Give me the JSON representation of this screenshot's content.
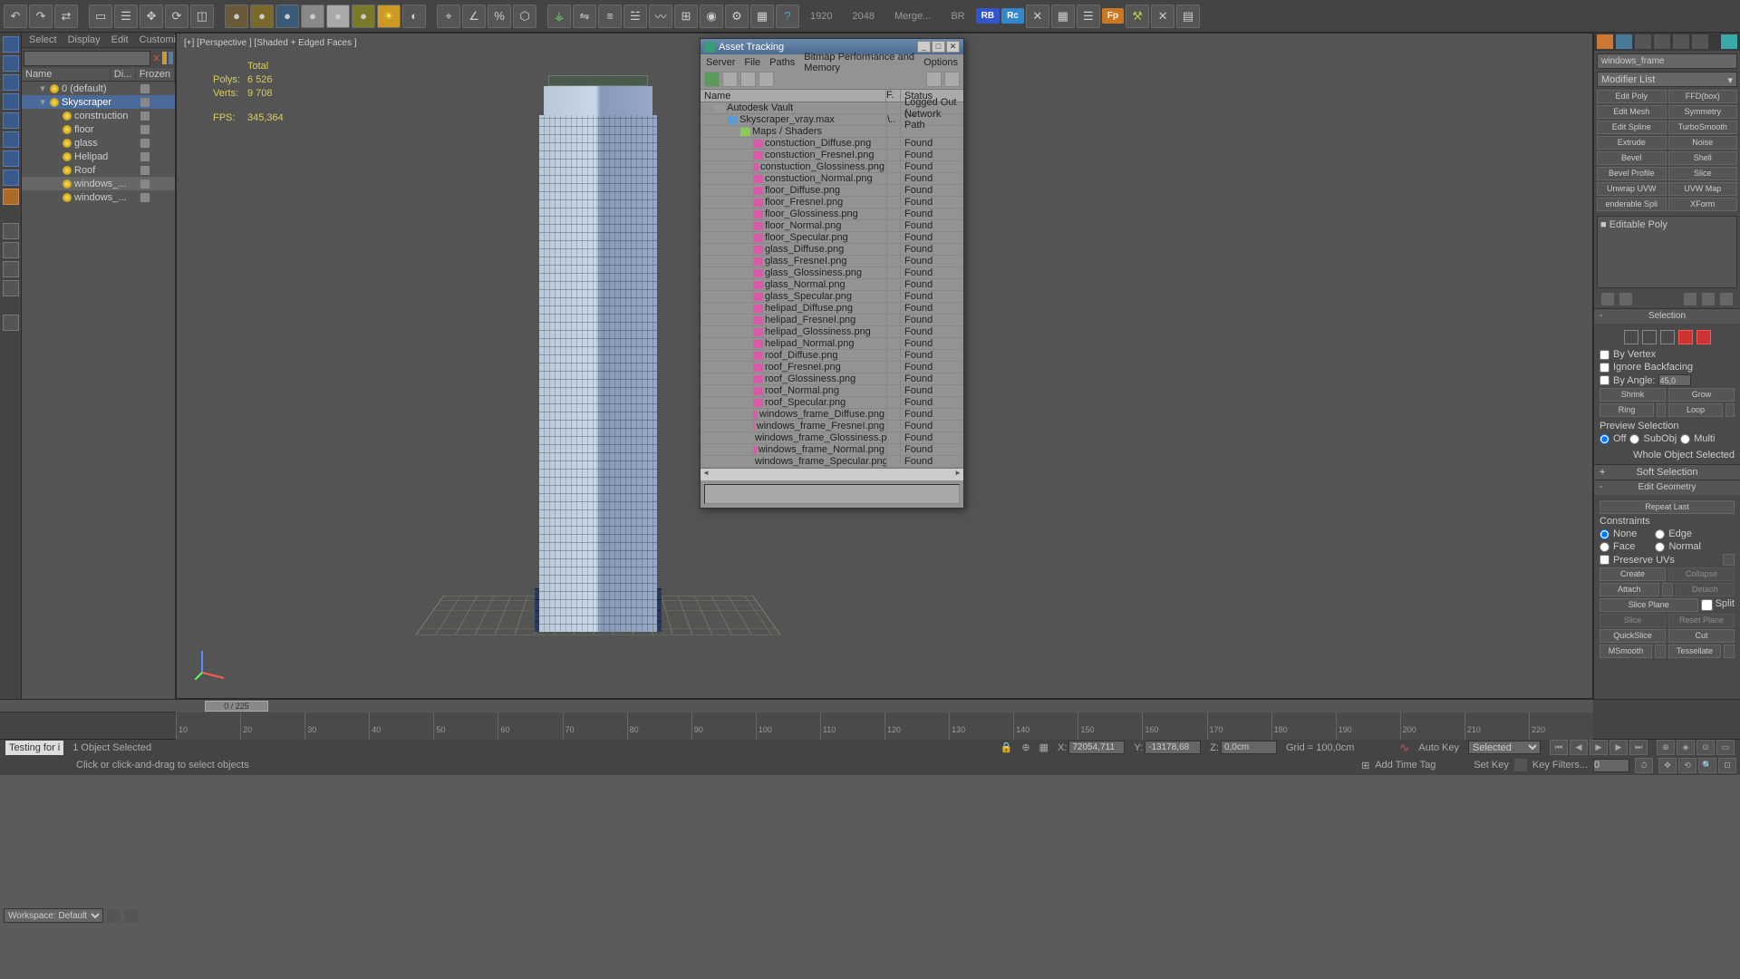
{
  "toolbar": {
    "dims": {
      "w": "1920",
      "h": "2048"
    },
    "merge": "Merge...",
    "br": "BR",
    "badges": {
      "rb": "RB",
      "rc": "Rc",
      "fp": "Fp"
    }
  },
  "scene_menu": {
    "select": "Select",
    "display": "Display",
    "edit": "Edit",
    "customize": "Customize"
  },
  "scene_cols": {
    "name": "Name",
    "di": "Di...",
    "frozen": "Frozen"
  },
  "tree": [
    {
      "ind": 1,
      "tw": "▾",
      "label": "0 (default)",
      "sel": false
    },
    {
      "ind": 1,
      "tw": "▾",
      "label": "Skyscraper",
      "sel": true
    },
    {
      "ind": 2,
      "tw": "",
      "label": "construction"
    },
    {
      "ind": 2,
      "tw": "",
      "label": "floor"
    },
    {
      "ind": 2,
      "tw": "",
      "label": "glass"
    },
    {
      "ind": 2,
      "tw": "",
      "label": "Helipad"
    },
    {
      "ind": 2,
      "tw": "",
      "label": "Roof"
    },
    {
      "ind": 2,
      "tw": "",
      "label": "windows_...",
      "sel2": true
    },
    {
      "ind": 2,
      "tw": "",
      "label": "windows_..."
    }
  ],
  "viewport": {
    "label": "[+] [Perspective ] [Shaded + Edged Faces ]",
    "stats_head": "Total",
    "polys_l": "Polys:",
    "polys_v": "6 526",
    "verts_l": "Verts:",
    "verts_v": "9 708",
    "fps_l": "FPS:",
    "fps_v": "345,364"
  },
  "asset": {
    "title": "Asset Tracking",
    "menu": [
      "Server",
      "File",
      "Paths",
      "Bitmap Performance and Memory",
      "Options"
    ],
    "cols": {
      "name": "Name",
      "f": "F.",
      "status": "Status"
    },
    "rows": [
      {
        "ind": 1,
        "ico": "vault",
        "name": "Autodesk Vault",
        "status": "Logged Out (..."
      },
      {
        "ind": 2,
        "ico": "max",
        "name": "Skyscraper_vray.max",
        "f": "\\..",
        "status": "Network Path"
      },
      {
        "ind": 3,
        "ico": "fold",
        "name": "Maps / Shaders",
        "status": ""
      },
      {
        "ind": 4,
        "ico": "png",
        "name": "constuction_Diffuse.png",
        "status": "Found"
      },
      {
        "ind": 4,
        "ico": "png",
        "name": "constuction_FresneI.png",
        "status": "Found"
      },
      {
        "ind": 4,
        "ico": "png",
        "name": "constuction_Glossiness.png",
        "status": "Found"
      },
      {
        "ind": 4,
        "ico": "png",
        "name": "constuction_Normal.png",
        "status": "Found"
      },
      {
        "ind": 4,
        "ico": "png",
        "name": "floor_Diffuse.png",
        "status": "Found"
      },
      {
        "ind": 4,
        "ico": "png",
        "name": "floor_FresneI.png",
        "status": "Found"
      },
      {
        "ind": 4,
        "ico": "png",
        "name": "floor_Glossiness.png",
        "status": "Found"
      },
      {
        "ind": 4,
        "ico": "png",
        "name": "floor_Normal.png",
        "status": "Found"
      },
      {
        "ind": 4,
        "ico": "png",
        "name": "floor_Specular.png",
        "status": "Found"
      },
      {
        "ind": 4,
        "ico": "png",
        "name": "glass_Diffuse.png",
        "status": "Found"
      },
      {
        "ind": 4,
        "ico": "png",
        "name": "glass_FresneI.png",
        "status": "Found"
      },
      {
        "ind": 4,
        "ico": "png",
        "name": "glass_Glossiness.png",
        "status": "Found"
      },
      {
        "ind": 4,
        "ico": "png",
        "name": "glass_Normal.png",
        "status": "Found"
      },
      {
        "ind": 4,
        "ico": "png",
        "name": "glass_Specular.png",
        "status": "Found"
      },
      {
        "ind": 4,
        "ico": "png",
        "name": "helipad_Diffuse.png",
        "status": "Found"
      },
      {
        "ind": 4,
        "ico": "png",
        "name": "helipad_FresneI.png",
        "status": "Found"
      },
      {
        "ind": 4,
        "ico": "png",
        "name": "helipad_Glossiness.png",
        "status": "Found"
      },
      {
        "ind": 4,
        "ico": "png",
        "name": "helipad_Normal.png",
        "status": "Found"
      },
      {
        "ind": 4,
        "ico": "png",
        "name": "roof_Diffuse.png",
        "status": "Found"
      },
      {
        "ind": 4,
        "ico": "png",
        "name": "roof_FresneI.png",
        "status": "Found"
      },
      {
        "ind": 4,
        "ico": "png",
        "name": "roof_Glossiness.png",
        "status": "Found"
      },
      {
        "ind": 4,
        "ico": "png",
        "name": "roof_Normal.png",
        "status": "Found"
      },
      {
        "ind": 4,
        "ico": "png",
        "name": "roof_Specular.png",
        "status": "Found"
      },
      {
        "ind": 4,
        "ico": "png",
        "name": "windows_frame_Diffuse.png",
        "status": "Found"
      },
      {
        "ind": 4,
        "ico": "png",
        "name": "windows_frame_FresneI.png",
        "status": "Found"
      },
      {
        "ind": 4,
        "ico": "png",
        "name": "windows_frame_Glossiness.png",
        "status": "Found"
      },
      {
        "ind": 4,
        "ico": "png",
        "name": "windows_frame_Normal.png",
        "status": "Found"
      },
      {
        "ind": 4,
        "ico": "png",
        "name": "windows_frame_Specular.png",
        "status": "Found"
      }
    ]
  },
  "right": {
    "obj_name": "windows_frame",
    "mod_list": "Modifier List",
    "mods": [
      "Edit Poly",
      "FFD(box)",
      "Edit Mesh",
      "Symmetry",
      "Edit Spline",
      "TurboSmooth",
      "Extrude",
      "Noise",
      "Bevel",
      "Shell",
      "Bevel Profile",
      "Slice",
      "Unwrap UVW",
      "UVW Map",
      "enderable Spli",
      "XForm"
    ],
    "stack": "■ Editable Poly",
    "ro_sel": "Selection",
    "by_vertex": "By Vertex",
    "ignore_bf": "Ignore Backfacing",
    "by_angle": "By Angle:",
    "angle_v": "45,0",
    "shrink": "Shrink",
    "grow": "Grow",
    "ring": "Ring",
    "loop": "Loop",
    "preview": "Preview Selection",
    "off": "Off",
    "subobj": "SubObj",
    "multi": "Multi",
    "whole": "Whole Object Selected",
    "ro_soft": "Soft Selection",
    "ro_geom": "Edit Geometry",
    "repeat": "Repeat Last",
    "constraints": "Constraints",
    "none": "None",
    "edge": "Edge",
    "face": "Face",
    "normal": "Normal",
    "preserve_uv": "Preserve UVs",
    "create": "Create",
    "collapse": "Collapse",
    "attach": "Attach",
    "detach": "Detach",
    "slice_plane": "Slice Plane",
    "split": "Split",
    "slice": "Slice",
    "reset_plane": "Reset Plane",
    "quickslice": "QuickSlice",
    "cut": "Cut",
    "msmooth": "MSmooth",
    "tessellate": "Tessellate"
  },
  "timeline": {
    "pos": "0 / 225",
    "ticks": [
      "10",
      "20",
      "30",
      "40",
      "50",
      "60",
      "70",
      "80",
      "90",
      "100",
      "110",
      "120",
      "130",
      "140",
      "150",
      "160",
      "170",
      "180",
      "190",
      "200",
      "210",
      "220"
    ]
  },
  "status": {
    "workspace": "Workspace: Default",
    "testing": "Testing for i",
    "sel": "1 Object Selected",
    "prompt": "Click or click-and-drag to select objects",
    "x": "72054,711",
    "y": "-13178,68",
    "z": "0,0cm",
    "grid": "Grid = 100,0cm",
    "add_tag": "Add Time Tag",
    "autokey": "Auto Key",
    "selected": "Selected",
    "setkey": "Set Key",
    "keyfilters": "Key Filters...",
    "zero": "0"
  }
}
